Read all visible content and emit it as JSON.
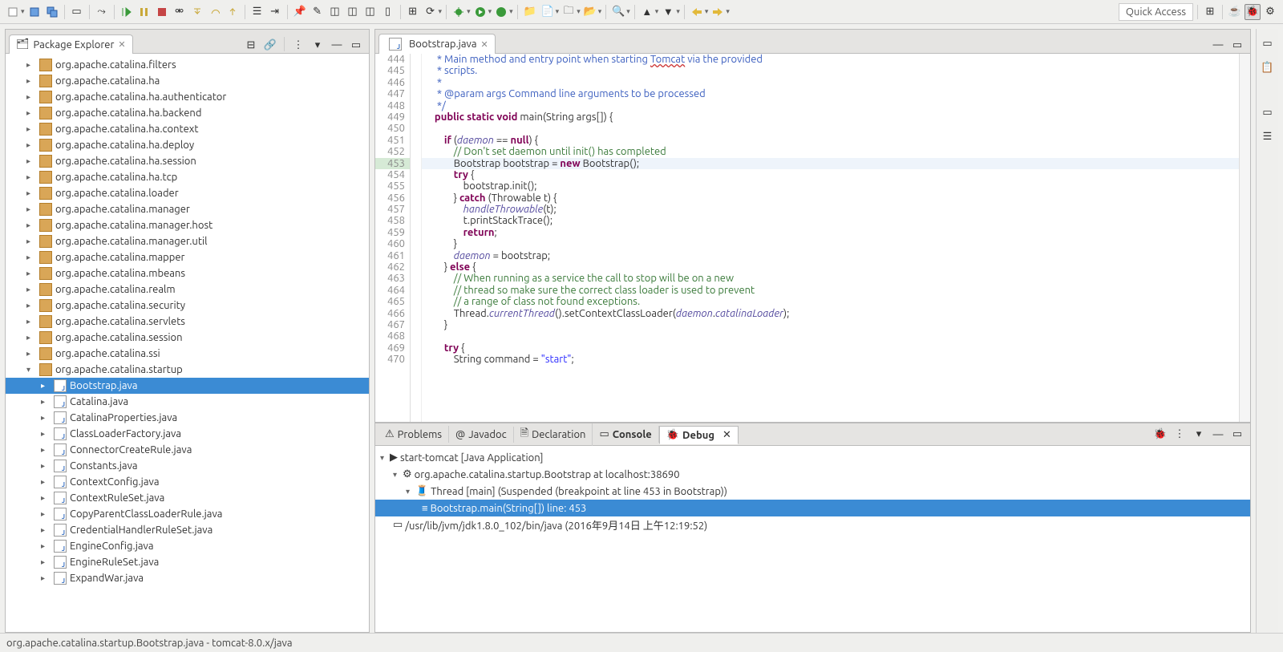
{
  "toolbar": {
    "quick_access": "Quick Access"
  },
  "package_explorer": {
    "title": "Package Explorer",
    "packages": [
      "org.apache.catalina.filters",
      "org.apache.catalina.ha",
      "org.apache.catalina.ha.authenticator",
      "org.apache.catalina.ha.backend",
      "org.apache.catalina.ha.context",
      "org.apache.catalina.ha.deploy",
      "org.apache.catalina.ha.session",
      "org.apache.catalina.ha.tcp",
      "org.apache.catalina.loader",
      "org.apache.catalina.manager",
      "org.apache.catalina.manager.host",
      "org.apache.catalina.manager.util",
      "org.apache.catalina.mapper",
      "org.apache.catalina.mbeans",
      "org.apache.catalina.realm",
      "org.apache.catalina.security",
      "org.apache.catalina.servlets",
      "org.apache.catalina.session",
      "org.apache.catalina.ssi",
      "org.apache.catalina.startup"
    ],
    "startup_files": [
      "Bootstrap.java",
      "Catalina.java",
      "CatalinaProperties.java",
      "ClassLoaderFactory.java",
      "ConnectorCreateRule.java",
      "Constants.java",
      "ContextConfig.java",
      "ContextRuleSet.java",
      "CopyParentClassLoaderRule.java",
      "CredentialHandlerRuleSet.java",
      "EngineConfig.java",
      "EngineRuleSet.java",
      "ExpandWar.java"
    ],
    "selected_file": "Bootstrap.java"
  },
  "editor": {
    "tab": "Bootstrap.java",
    "first_line": 444,
    "highlight_line": 453,
    "lines": [
      {
        "n": 444,
        "cls": "jd",
        "t": "     * Main method and entry point when starting Tomcat via the provided",
        "err": "Tomcat"
      },
      {
        "n": 445,
        "cls": "jd",
        "t": "     * scripts."
      },
      {
        "n": 446,
        "cls": "jd",
        "t": "     *"
      },
      {
        "n": 447,
        "cls": "jd",
        "t": "     * @param args Command line arguments to be processed"
      },
      {
        "n": 448,
        "cls": "jd",
        "t": "     */"
      },
      {
        "n": 449,
        "raw": "    <span class='kw'>public static void</span> main(String args[]) {"
      },
      {
        "n": 450,
        "t": ""
      },
      {
        "n": 451,
        "raw": "        <span class='kw'>if</span> (<span class='it'>daemon</span> == <span class='kw'>null</span>) {"
      },
      {
        "n": 452,
        "raw": "            <span class='cm'>// Don't set daemon until init() has completed</span>"
      },
      {
        "n": 453,
        "hl": true,
        "raw": "            Bootstrap bootstrap = <span class='kw'>new</span> Bootstrap();"
      },
      {
        "n": 454,
        "raw": "            <span class='kw'>try</span> {"
      },
      {
        "n": 455,
        "raw": "                bootstrap.init();"
      },
      {
        "n": 456,
        "raw": "            } <span class='kw'>catch</span> (Throwable t) {"
      },
      {
        "n": 457,
        "raw": "                <span class='it'>handleThrowable</span>(t);"
      },
      {
        "n": 458,
        "raw": "                t.printStackTrace();"
      },
      {
        "n": 459,
        "raw": "                <span class='kw'>return</span>;"
      },
      {
        "n": 460,
        "raw": "            }"
      },
      {
        "n": 461,
        "raw": "            <span class='it'>daemon</span> = bootstrap;"
      },
      {
        "n": 462,
        "raw": "        } <span class='kw'>else</span> {"
      },
      {
        "n": 463,
        "raw": "            <span class='cm'>// When running as a service the call to stop will be on a new</span>"
      },
      {
        "n": 464,
        "raw": "            <span class='cm'>// thread so make sure the correct class loader is used to prevent</span>"
      },
      {
        "n": 465,
        "raw": "            <span class='cm'>// a range of class not found exceptions.</span>"
      },
      {
        "n": 466,
        "raw": "            Thread.<span class='it'>currentThread</span>().setContextClassLoader(<span class='it'>daemon</span>.<span class='it'>catalinaLoader</span>);"
      },
      {
        "n": 467,
        "raw": "        }"
      },
      {
        "n": 468,
        "t": ""
      },
      {
        "n": 469,
        "raw": "        <span class='kw'>try</span> {"
      },
      {
        "n": 470,
        "raw": "            String command = <span class='str'>\"start\"</span>;"
      }
    ]
  },
  "bottom_tabs": {
    "problems": "Problems",
    "javadoc": "Javadoc",
    "declaration": "Declaration",
    "console": "Console",
    "debug": "Debug"
  },
  "debug": {
    "launch": "start-tomcat [Java Application]",
    "process": "org.apache.catalina.startup.Bootstrap at localhost:38690",
    "thread": "Thread [main] (Suspended (breakpoint at line 453 in Bootstrap))",
    "frame": "Bootstrap.main(String[]) line: 453",
    "jvm": "/usr/lib/jvm/jdk1.8.0_102/bin/java (2016年9月14日 上午12:19:52)"
  },
  "status": {
    "path": "org.apache.catalina.startup.Bootstrap.java - tomcat-8.0.x/java"
  }
}
